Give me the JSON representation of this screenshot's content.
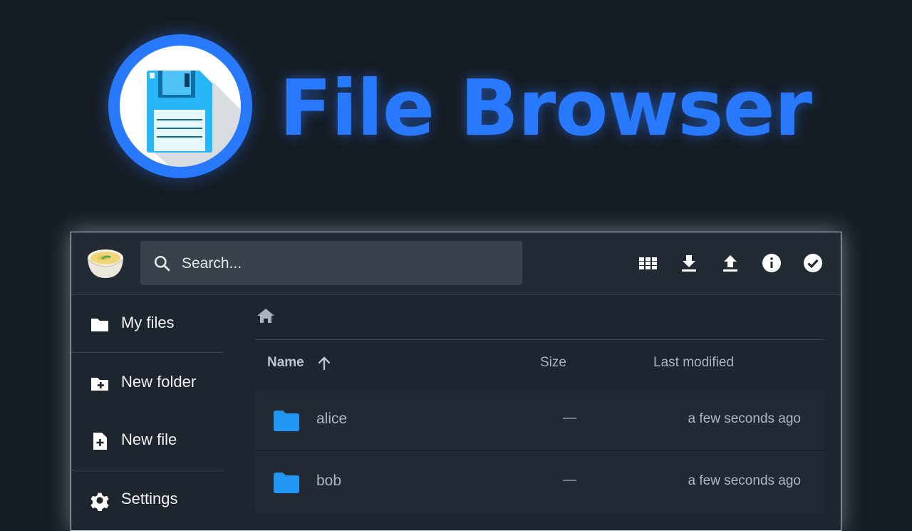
{
  "hero": {
    "title": "File Browser",
    "icon": "floppy-disk-icon",
    "accent_color": "#2979ff"
  },
  "topbar": {
    "logo": "soup-bowl-logo",
    "search": {
      "placeholder": "Search...",
      "value": ""
    },
    "actions": [
      {
        "icon": "grid-view-icon",
        "name": "toggle-view-button"
      },
      {
        "icon": "download-icon",
        "name": "download-button"
      },
      {
        "icon": "upload-icon",
        "name": "upload-button"
      },
      {
        "icon": "info-icon",
        "name": "info-button"
      },
      {
        "icon": "check-circle-icon",
        "name": "select-button"
      }
    ]
  },
  "sidebar": {
    "items": [
      {
        "label": "My files",
        "icon": "folder-icon"
      },
      {
        "label": "New folder",
        "icon": "new-folder-icon"
      },
      {
        "label": "New file",
        "icon": "new-file-icon"
      },
      {
        "label": "Settings",
        "icon": "gear-icon"
      }
    ]
  },
  "breadcrumb": {
    "icon": "home-icon"
  },
  "listing": {
    "columns": {
      "name": "Name",
      "size": "Size",
      "modified": "Last modified"
    },
    "sort": {
      "column": "name",
      "direction": "ascending",
      "icon": "arrow-up-icon"
    },
    "rows": [
      {
        "name": "alice",
        "size": "—",
        "modified": "a few seconds ago",
        "icon": "folder-icon"
      },
      {
        "name": "bob",
        "size": "—",
        "modified": "a few seconds ago",
        "icon": "folder-icon"
      }
    ]
  }
}
